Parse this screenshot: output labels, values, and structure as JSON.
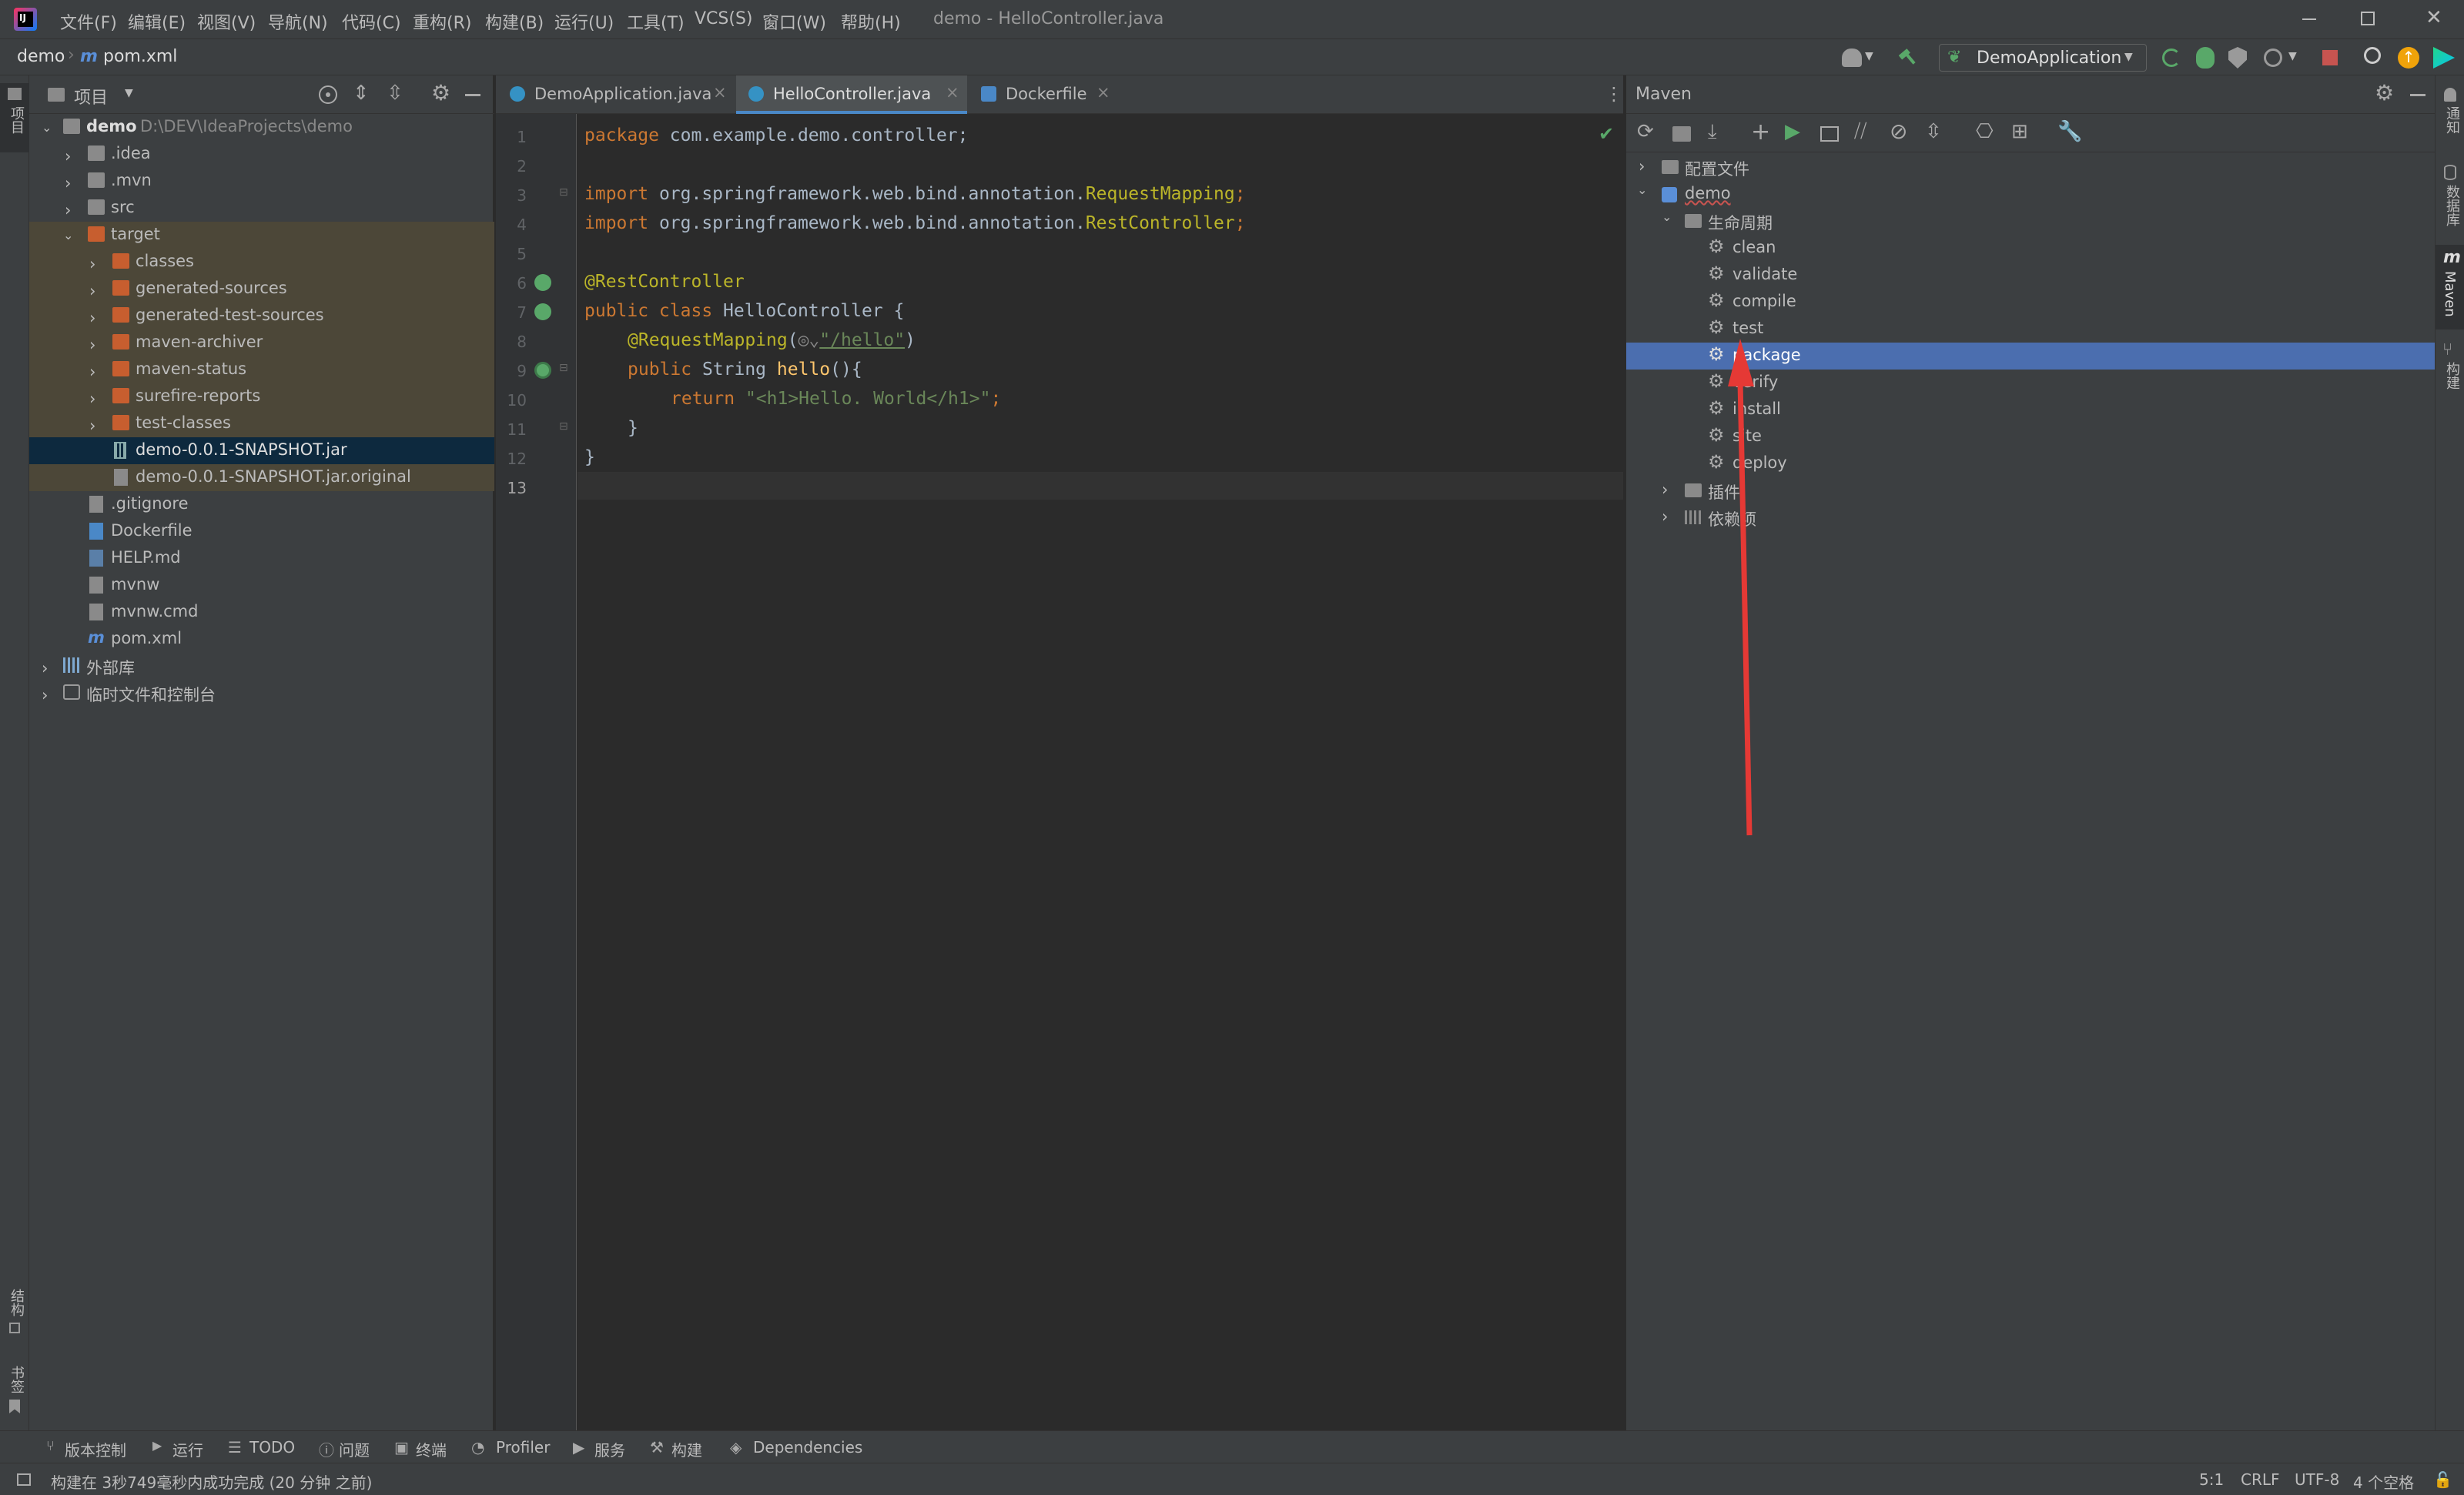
{
  "window": {
    "title": "demo - HelloController.java"
  },
  "menus": [
    "文件(F)",
    "编辑(E)",
    "视图(V)",
    "导航(N)",
    "代码(C)",
    "重构(R)",
    "构建(B)",
    "运行(U)",
    "工具(T)",
    "VCS(S)",
    "窗口(W)",
    "帮助(H)"
  ],
  "breadcrumb": {
    "project": "demo",
    "file": "pom.xml"
  },
  "run_config": {
    "label": "DemoApplication"
  },
  "left_strip": {
    "project_label": "项目",
    "structure_label": "结构",
    "bookmarks_label": "书签"
  },
  "right_strip": {
    "notifications_label": "通知",
    "database_label": "数据库",
    "maven_label": "Maven",
    "gradle_label": "构建"
  },
  "project_panel": {
    "title": "项目",
    "root_name": "demo",
    "root_path": "D:\\DEV\\IdeaProjects\\demo",
    "items": [
      ".idea",
      ".mvn",
      "src",
      "target",
      "classes",
      "generated-sources",
      "generated-test-sources",
      "maven-archiver",
      "maven-status",
      "surefire-reports",
      "test-classes",
      "demo-0.0.1-SNAPSHOT.jar",
      "demo-0.0.1-SNAPSHOT.jar.original",
      ".gitignore",
      "Dockerfile",
      "HELP.md",
      "mvnw",
      "mvnw.cmd",
      "pom.xml",
      "外部库",
      "临时文件和控制台"
    ]
  },
  "editor": {
    "tabs": [
      "DemoApplication.java",
      "HelloController.java",
      "Dockerfile"
    ],
    "line_numbers": [
      "1",
      "2",
      "3",
      "4",
      "5",
      "6",
      "7",
      "8",
      "9",
      "10",
      "11",
      "12",
      "13"
    ],
    "code": {
      "l1_kw": "package",
      "l1_rest": " com.example.demo.controller;",
      "l3_kw": "import",
      "l3_pkg": " org.springframework.web.bind.annotation.",
      "l3_cls": "RequestMapping",
      "l3_end": ";",
      "l4_kw": "import",
      "l4_pkg": " org.springframework.web.bind.annotation.",
      "l4_cls": "RestController",
      "l4_end": ";",
      "l6_ann": "@RestController",
      "l7_kw": "public class",
      "l7_rest": " HelloController {",
      "l8_ann": "@RequestMapping",
      "l8_open": "(",
      "l8_str": "\"/hello\"",
      "l8_close": ")",
      "l9_kw": "public",
      "l9_type": " String ",
      "l9_fn": "hello",
      "l9_rest": "(){",
      "l10_kw": "return",
      "l10_str": " \"<h1>Hello. World</h1>\"",
      "l10_end": ";",
      "l11": "}",
      "l12": "}"
    }
  },
  "maven": {
    "title": "Maven",
    "profiles": "配置文件",
    "project": "demo",
    "lifecycle": "生命周期",
    "phases": [
      "clean",
      "validate",
      "compile",
      "test",
      "package",
      "verify",
      "install",
      "site",
      "deploy"
    ],
    "plugins": "插件",
    "dependencies": "依赖项",
    "selected_phase": "package"
  },
  "bottom_tools": [
    "版本控制",
    "运行",
    "TODO",
    "问题",
    "终端",
    "Profiler",
    "服务",
    "构建",
    "Dependencies"
  ],
  "status": {
    "message": "构建在 3秒749毫秒内成功完成 (20 分钟 之前)",
    "position": "5:1",
    "line_sep": "CRLF",
    "encoding": "UTF-8",
    "indent": "4 个空格"
  },
  "colors": {
    "accent": "#4b6eaf",
    "folder_excluded": "#c75e2f",
    "annotation_arrow": "#e53935"
  }
}
